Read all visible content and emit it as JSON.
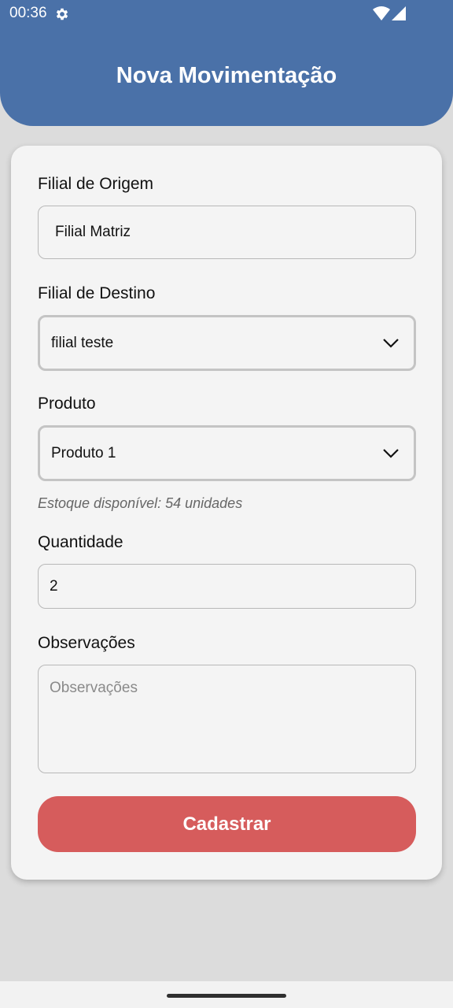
{
  "status_bar": {
    "time": "00:36",
    "icons": [
      "gear-icon",
      "wifi-icon",
      "signal-icon"
    ]
  },
  "header": {
    "title": "Nova Movimentação",
    "color": "#4a71a8"
  },
  "form": {
    "origin": {
      "label": "Filial de Origem",
      "value": "Filial Matriz"
    },
    "destination": {
      "label": "Filial de Destino",
      "value": "filial teste"
    },
    "product": {
      "label": "Produto",
      "value": "Produto 1"
    },
    "stock_hint": "Estoque disponível: 54 unidades",
    "quantity": {
      "label": "Quantidade",
      "value": "2"
    },
    "notes": {
      "label": "Observações",
      "placeholder": "Observações"
    },
    "submit_label": "Cadastrar",
    "submit_color": "#d65c5c"
  }
}
